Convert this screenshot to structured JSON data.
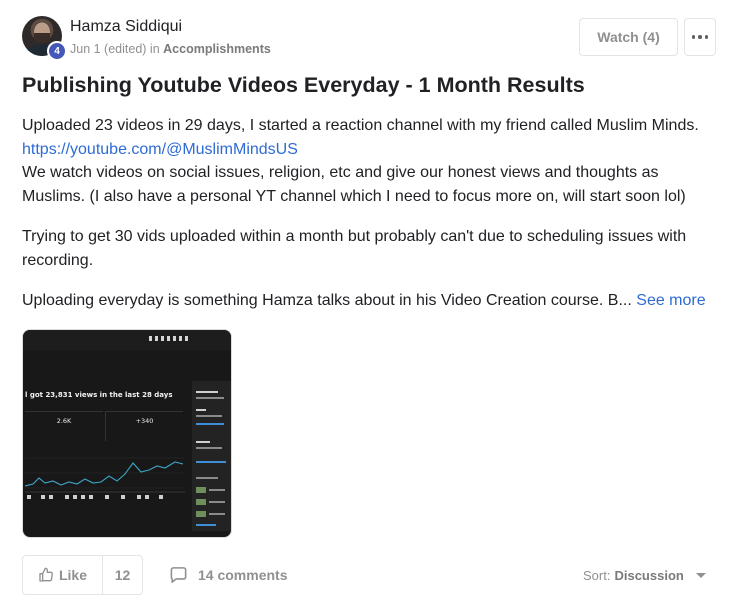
{
  "post": {
    "author": "Hamza Siddiqui",
    "level": "4",
    "date": "Jun 1 (edited)",
    "in_word": "in",
    "category": "Accomplishments",
    "watch_label": "Watch (4)",
    "title": "Publishing Youtube Videos Everyday - 1 Month Results",
    "paragraph1_line1": "Uploaded 23 videos in 29 days, I started a reaction channel with my friend called Muslim Minds.",
    "link": "https://youtube.com/@MuslimMindsUS",
    "paragraph1_line3": "We watch videos on social issues, religion, etc and give our honest views and thoughts as Muslims. (I also have a personal YT channel which I need to focus more on, will start soon lol)",
    "paragraph2": "Trying to get 30 vids uploaded within a month but probably can't due to scheduling issues with recording.",
    "paragraph3": "Uploading everyday is something Hamza talks about in his Video Creation course. B...",
    "see_more": "See more"
  },
  "thumbnail": {
    "headline": "l got 23,831 views in the last 28 days",
    "stat1_value": "2.6K",
    "stat2_value": "+340"
  },
  "footer": {
    "like_label": "Like",
    "like_count": "12",
    "comments_label": "14 comments",
    "sort_label": "Sort:",
    "sort_value": "Discussion"
  },
  "icons": {
    "more": "more-horizontal-icon",
    "like": "thumbs-up-icon",
    "comment": "comment-bubble-icon",
    "caret": "caret-down-icon"
  },
  "colors": {
    "link": "#2e6bd4",
    "badge": "#4557b8",
    "muted": "#909090"
  }
}
